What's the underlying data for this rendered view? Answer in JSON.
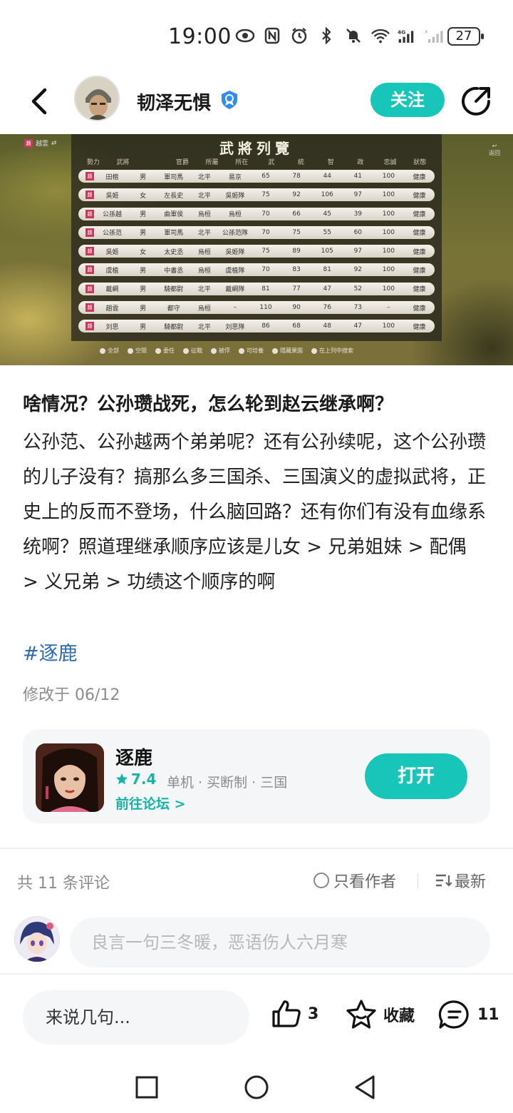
{
  "status": {
    "time": "19:00",
    "battery": "27",
    "icons": [
      "eye-icon",
      "nfc-icon",
      "alarm-icon",
      "bluetooth-icon",
      "mute-icon",
      "wifi-icon",
      "signal-4g-icon",
      "signal-icon"
    ]
  },
  "header": {
    "username": "韧泽无惧",
    "follow_label": "关注"
  },
  "screenshot": {
    "title": "武將列覽",
    "faction_tag": "趙",
    "faction_name": "越霊",
    "return_label": "返回",
    "columns": [
      "勢力",
      "武將",
      "",
      "官爵",
      "所屬",
      "所在",
      "武",
      "統",
      "智",
      "政",
      "忠誠",
      "狀態"
    ],
    "rows": [
      [
        "趙",
        "田楷",
        "男",
        "軍司馬",
        "北平",
        "易京",
        "65",
        "78",
        "44",
        "41",
        "100",
        "健康"
      ],
      [
        "趙",
        "吳姬",
        "女",
        "左長史",
        "北平",
        "吳姬隊",
        "75",
        "92",
        "106",
        "97",
        "100",
        "健康"
      ],
      [
        "趙",
        "公孫越",
        "男",
        "曲軍侯",
        "烏桓",
        "烏桓",
        "70",
        "66",
        "45",
        "39",
        "100",
        "健康"
      ],
      [
        "趙",
        "公孫范",
        "男",
        "軍司馬",
        "北平",
        "公孫范隊",
        "70",
        "75",
        "55",
        "60",
        "100",
        "健康"
      ],
      [
        "趙",
        "吳姬",
        "女",
        "太史丞",
        "烏桓",
        "吳姬隊",
        "75",
        "89",
        "105",
        "97",
        "100",
        "健康"
      ],
      [
        "趙",
        "虞植",
        "男",
        "中書丞",
        "烏桓",
        "虞植隊",
        "70",
        "83",
        "81",
        "92",
        "100",
        "健康"
      ],
      [
        "趙",
        "戴綱",
        "男",
        "騎都尉",
        "北平",
        "戴綱隊",
        "81",
        "77",
        "47",
        "52",
        "100",
        "健康"
      ],
      [
        "趙",
        "趙雲",
        "男",
        "都守",
        "烏桓",
        "–",
        "110",
        "90",
        "76",
        "73",
        "–",
        "健康"
      ],
      [
        "趙",
        "刘思",
        "男",
        "騎都尉",
        "北平",
        "刘思隊",
        "86",
        "68",
        "48",
        "47",
        "100",
        "健康"
      ]
    ],
    "filters": [
      "全部",
      "空閒",
      "委任",
      "征戰",
      "被俘",
      "可培養",
      "隱藏果園",
      "在上列中搜索"
    ]
  },
  "post": {
    "title": "啥情况？公孙瓒战死，怎么轮到赵云继承啊？",
    "body": "公孙范、公孙越两个弟弟呢？还有公孙续呢，这个公孙瓒的儿子没有？搞那么多三国杀、三国演义的虚拟武将，正史上的反而不登场，什么脑回路？还有你们有没有血缘系统啊？照道理继承顺序应该是儿女 > 兄弟姐妹 > 配偶 > 义兄弟 > 功绩这个顺序的啊",
    "hashtag": "#逐鹿",
    "modified": "修改于 06/12"
  },
  "game": {
    "name": "逐鹿",
    "rating": "7.4",
    "tags": "单机 · 买断制 · 三国",
    "forum_link": "前往论坛 >",
    "open_label": "打开"
  },
  "comments": {
    "count_label": "共 11 条评论",
    "author_only": "只看作者",
    "sort": "最新",
    "input_placeholder": "良言一句三冬暖，恶语伤人六月寒"
  },
  "bottom": {
    "say_placeholder": "来说几句...",
    "likes": "3",
    "collect": "收藏",
    "comments": "11"
  },
  "colors": {
    "accent": "#17c6b8",
    "hashtag": "#2b6cb0"
  }
}
